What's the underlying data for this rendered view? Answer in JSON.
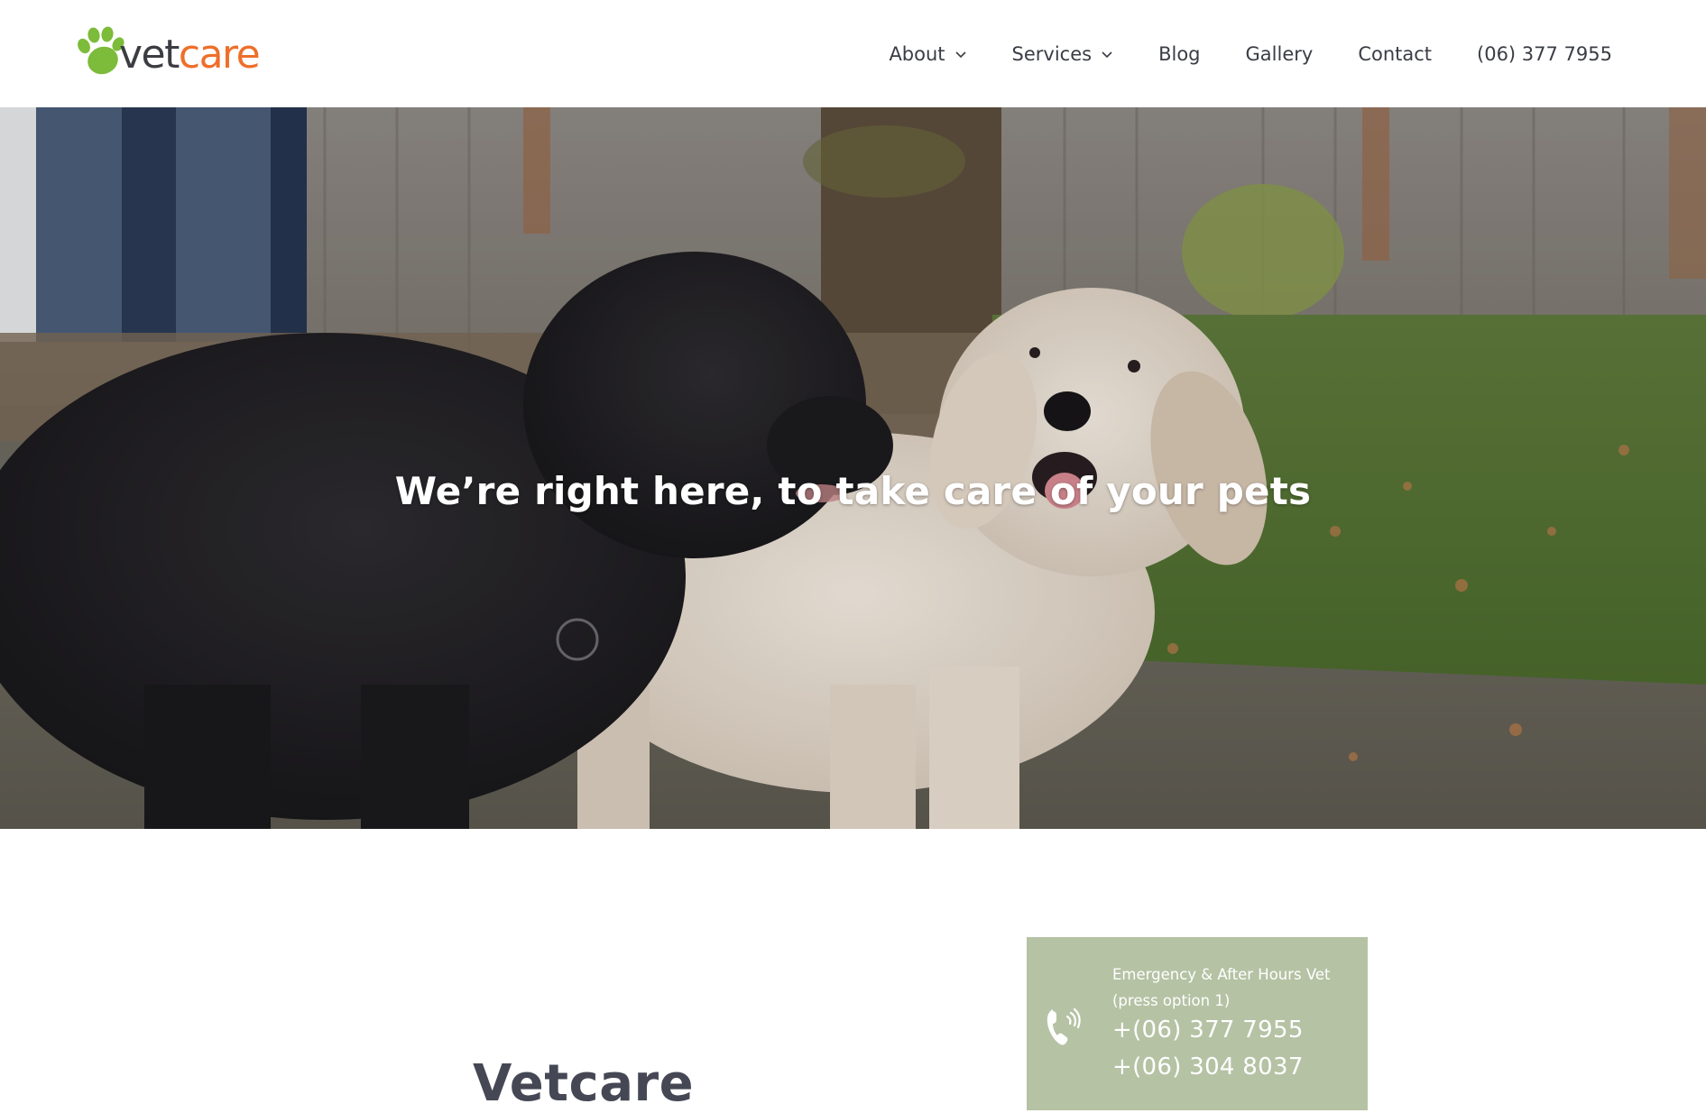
{
  "header": {
    "logo": {
      "part1": "vet",
      "part2": "care",
      "icon": "paw-icon"
    },
    "nav": [
      {
        "label": "About",
        "has_dropdown": true
      },
      {
        "label": "Services",
        "has_dropdown": true
      },
      {
        "label": "Blog",
        "has_dropdown": false
      },
      {
        "label": "Gallery",
        "has_dropdown": false
      },
      {
        "label": "Contact",
        "has_dropdown": false
      },
      {
        "label": "(06) 377 7955",
        "has_dropdown": false
      }
    ]
  },
  "hero": {
    "headline": "We’re right here, to take care of your pets"
  },
  "main": {
    "title": "Vetcare",
    "emergency": {
      "label": "Emergency & After Hours Vet (press option 1)",
      "phones": [
        "+(06) 377 7955",
        "+(06) 304 8037"
      ],
      "icon": "phone-icon"
    }
  },
  "colors": {
    "brand_green": "#7dbb3a",
    "brand_orange": "#ee6f2a",
    "emergency_bg": "#b5c2a4",
    "text_dark": "#3a3d45"
  }
}
